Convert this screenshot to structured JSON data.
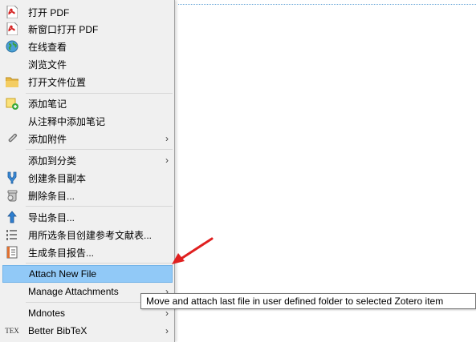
{
  "menu": {
    "items": [
      {
        "label": "打开 PDF",
        "icon": "pdf-icon"
      },
      {
        "label": "新窗口打开 PDF",
        "icon": "pdf-icon"
      },
      {
        "label": "在线查看",
        "icon": "globe-icon"
      },
      {
        "label": "浏览文件",
        "icon": ""
      },
      {
        "label": "打开文件位置",
        "icon": "folder-icon"
      },
      {
        "label": "添加笔记",
        "icon": "note-add-icon"
      },
      {
        "label": "从注释中添加笔记",
        "icon": ""
      },
      {
        "label": "添加附件",
        "icon": "paperclip-icon",
        "submenu": true
      },
      {
        "label": "添加到分类",
        "icon": "",
        "submenu": true
      },
      {
        "label": "创建条目副本",
        "icon": "duplicate-icon"
      },
      {
        "label": "删除条目...",
        "icon": "trash-icon"
      },
      {
        "label": "导出条目...",
        "icon": "export-icon"
      },
      {
        "label": "用所选条目创建参考文献表...",
        "icon": "bibliography-icon"
      },
      {
        "label": "生成条目报告...",
        "icon": "report-icon"
      },
      {
        "label": "Attach New File",
        "icon": "",
        "highlighted": true
      },
      {
        "label": "Manage Attachments",
        "icon": "",
        "submenu": true
      },
      {
        "label": "Mdnotes",
        "icon": "",
        "submenu": true
      },
      {
        "label": "Better BibTeX",
        "icon": "tex-icon",
        "submenu": true
      }
    ]
  },
  "submenu_glyph": "›",
  "tex_glyph": "TEX",
  "tooltip": {
    "text": "Move and attach last file in user defined folder to selected Zotero item"
  },
  "colors": {
    "highlight": "#91c9f7",
    "menu_bg": "#f0f0f0",
    "annotation_arrow": "#e02020"
  }
}
